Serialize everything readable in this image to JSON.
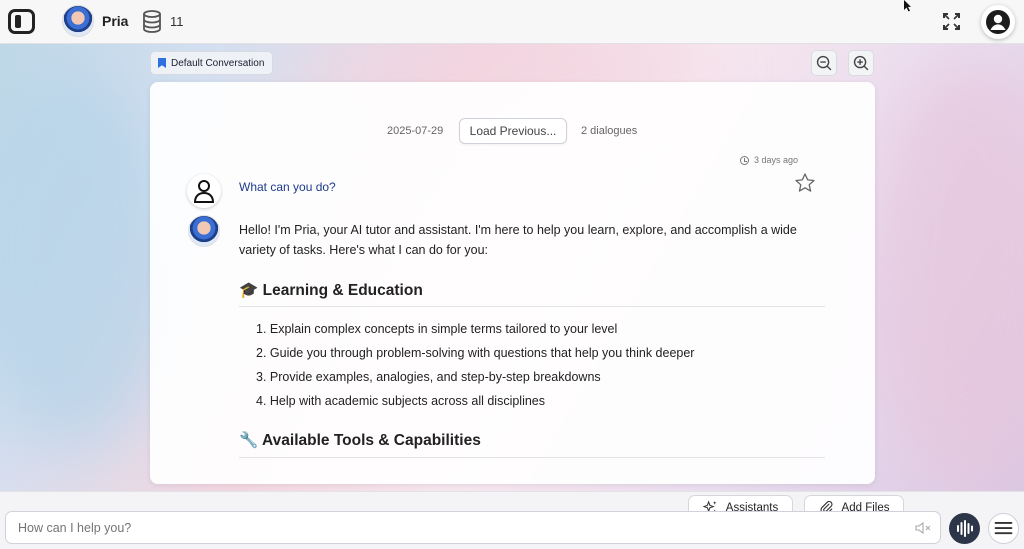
{
  "header": {
    "brand": "Pria",
    "count": "11"
  },
  "conversation": {
    "tag": "Default Conversation",
    "date": "2025-07-29",
    "load_previous": "Load Previous...",
    "dialogues": "2 dialogues",
    "timestamp": "3 days ago"
  },
  "messages": {
    "question": "What can you do?",
    "intro": "Hello! I'm Pria, your AI tutor and assistant. I'm here to help you learn, explore, and accomplish a wide variety of tasks. Here's what I can do for you:",
    "section1": "🎓 Learning & Education",
    "list": [
      "1. Explain complex concepts in simple terms tailored to your level",
      "2. Guide you through problem-solving with questions that help you think deeper",
      "3. Provide examples, analogies, and step-by-step breakdowns",
      "4. Help with academic subjects across all disciplines"
    ],
    "section2": "🔧 Available Tools & Capabilities"
  },
  "composer": {
    "placeholder": "How can I help you?",
    "assistants": "Assistants",
    "add_files": "Add Files"
  },
  "icons": {
    "app": "sidebar-toggle-icon",
    "database": "database-icon",
    "fullscreen": "fullscreen-icon",
    "account": "user-account-icon",
    "bookmark": "bookmark-icon",
    "zoom_out": "zoom-out-icon",
    "zoom_in": "zoom-in-icon",
    "clock": "clock-icon",
    "star": "star-icon",
    "sparkle": "sparkle-icon",
    "paperclip": "paperclip-icon",
    "mute": "speaker-mute-icon",
    "voice": "voice-wave-icon",
    "menu": "hamburger-menu-icon"
  },
  "colors": {
    "accent": "#2f6fe0",
    "question_text": "#1d3c8c",
    "voice_button": "#2d3648"
  }
}
